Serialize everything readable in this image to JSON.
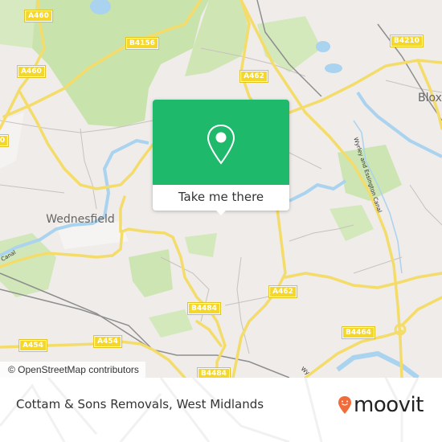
{
  "map": {
    "road_labels": [
      {
        "id": "a460-1",
        "text": "A460"
      },
      {
        "id": "a460-2",
        "text": "A460"
      },
      {
        "id": "a460-3",
        "text": "0"
      },
      {
        "id": "b4156",
        "text": "B4156"
      },
      {
        "id": "a462-1",
        "text": "A462"
      },
      {
        "id": "b4210",
        "text": "B4210"
      },
      {
        "id": "a462-2",
        "text": "A462"
      },
      {
        "id": "b4484-1",
        "text": "B4484"
      },
      {
        "id": "b4464",
        "text": "B4464"
      },
      {
        "id": "a454-1",
        "text": "A454"
      },
      {
        "id": "a454-2",
        "text": "A454"
      },
      {
        "id": "b4484-2",
        "text": "B4484"
      }
    ],
    "place_labels": [
      {
        "id": "wednesfield",
        "text": "Wednesfield"
      },
      {
        "id": "bloxwich",
        "text": "Blox"
      }
    ],
    "canal_labels": [
      {
        "id": "wyrley",
        "text": "Wyrley and Essington Canal"
      },
      {
        "id": "canal-left",
        "text": "Canal"
      },
      {
        "id": "canal-bottom",
        "text": "Wy"
      }
    ],
    "attribution": "© OpenStreetMap contributors"
  },
  "popup": {
    "icon": "map-pin-icon",
    "action_label": "Take me there",
    "color": "#1fb96c"
  },
  "footer": {
    "title": "Cottam & Sons Removals, West Midlands",
    "brand": "moovit",
    "brand_color": "#f26b3a"
  }
}
